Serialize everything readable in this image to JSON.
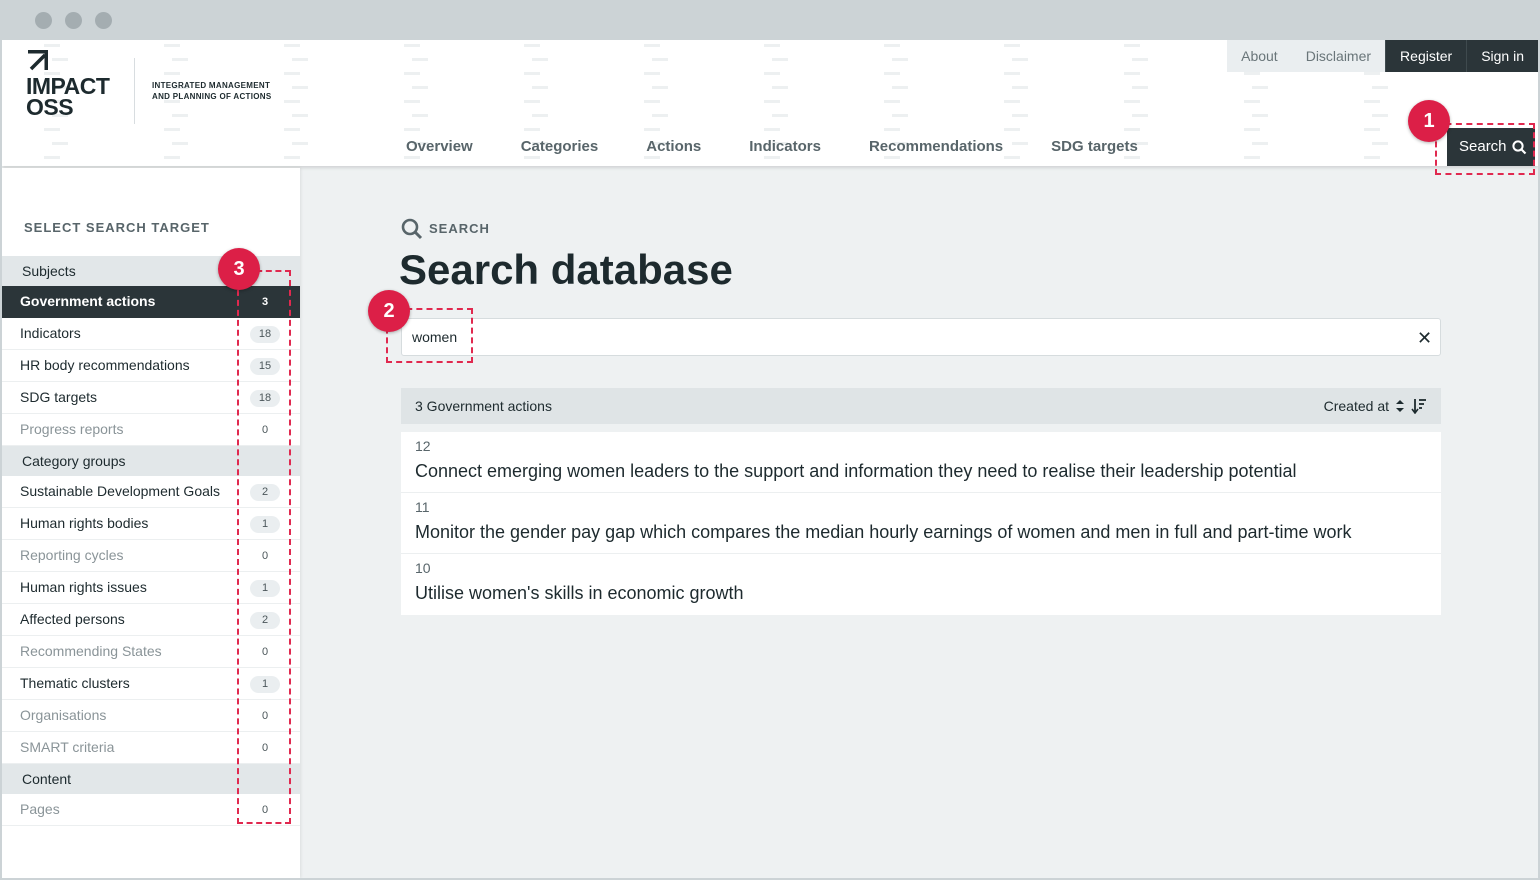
{
  "logo": {
    "name_line1": "IMPACT",
    "name_line2": "OSS",
    "tagline_line1": "INTEGRATED MANAGEMENT",
    "tagline_line2": "AND PLANNING OF ACTIONS"
  },
  "topnav": {
    "about": "About",
    "disclaimer": "Disclaimer",
    "register": "Register",
    "signin": "Sign in"
  },
  "mainnav": {
    "items": [
      "Overview",
      "Categories",
      "Actions",
      "Indicators",
      "Recommendations",
      "SDG targets"
    ]
  },
  "search_button": {
    "label": "Search"
  },
  "sidebar": {
    "title": "SELECT SEARCH TARGET",
    "groups": [
      {
        "label": "Subjects",
        "items": [
          {
            "label": "Government actions",
            "count": "3"
          },
          {
            "label": "Indicators",
            "count": "18"
          },
          {
            "label": "HR body recommendations",
            "count": "15"
          },
          {
            "label": "SDG targets",
            "count": "18"
          },
          {
            "label": "Progress reports",
            "count": "0"
          }
        ]
      },
      {
        "label": "Category groups",
        "items": [
          {
            "label": "Sustainable Development Goals",
            "count": "2"
          },
          {
            "label": "Human rights bodies",
            "count": "1"
          },
          {
            "label": "Reporting cycles",
            "count": "0"
          },
          {
            "label": "Human rights issues",
            "count": "1"
          },
          {
            "label": "Affected persons",
            "count": "2"
          },
          {
            "label": "Recommending States",
            "count": "0"
          },
          {
            "label": "Thematic clusters",
            "count": "1"
          },
          {
            "label": "Organisations",
            "count": "0"
          },
          {
            "label": "SMART criteria",
            "count": "0"
          }
        ]
      },
      {
        "label": "Content",
        "items": [
          {
            "label": "Pages",
            "count": "0"
          }
        ]
      }
    ]
  },
  "main": {
    "supertitle": "SEARCH",
    "title": "Search database",
    "query": "women",
    "clear_symbol": "✕",
    "results_header": "3 Government actions",
    "sort_label": "Created at",
    "results": [
      {
        "ref": "12",
        "title": "Connect emerging women leaders to the support and information they need to realise their leadership potential"
      },
      {
        "ref": "11",
        "title": "Monitor the gender pay gap which compares the median hourly earnings of women and men in full and part-time work"
      },
      {
        "ref": "10",
        "title": "Utilise women's skills in economic growth"
      }
    ]
  },
  "annotations": {
    "badge1": "1",
    "badge2": "2",
    "badge3": "3"
  },
  "colors": {
    "dark": "#2b3539",
    "annotation": "#dc1f47",
    "background": "#eef1f2"
  }
}
